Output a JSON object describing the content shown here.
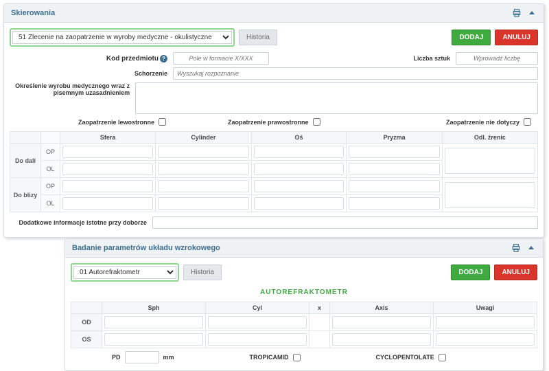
{
  "panel1": {
    "title": "Skierowania",
    "select": "51 Zlecenie na zaopatrzenie w wyroby medyczne - okulistyczne",
    "historyBtn": "Historia",
    "addBtn": "DODAJ",
    "cancelBtn": "ANULUJ",
    "labels": {
      "kod": "Kod przedmiotu",
      "liczba": "Liczba sztuk",
      "schorzenie": "Schorzenie",
      "okreslenie": "Określenie wyrobu medycznego wraz z pisemnym uzasadnieniem",
      "dodatkowe": "Dodatkowe informacje istotne przy doborze"
    },
    "placeholders": {
      "kod": "Pole w formacie X/XXX",
      "liczba": "Wprowadź liczbę",
      "schorzenie": "Wyszukaj rozpoznanie"
    },
    "chk": {
      "lewo": "Zaopatrzenie lewostronne",
      "prawo": "Zaopatrzenie prawostronne",
      "nie": "Zaopatrzenie nie dotyczy"
    },
    "grid": {
      "cols": [
        "Sfera",
        "Cylinder",
        "Oś",
        "Pryzma",
        "Odl. źrenic"
      ],
      "rows": [
        "Do dali",
        "Do blizy"
      ],
      "eyes": [
        "OP",
        "OL"
      ]
    }
  },
  "panel2": {
    "title": "Badanie parametrów układu wzrokowego",
    "select": "01 Autorefraktometr",
    "historyBtn": "Historia",
    "addBtn": "DODAJ",
    "cancelBtn": "ANULUJ",
    "deviceTitle": "AUTOREFRAKTOMETR",
    "grid": {
      "cols": [
        "Sph",
        "Cyl",
        "x",
        "Axis",
        "Uwagi"
      ],
      "eyes": [
        "OD",
        "OS"
      ]
    },
    "pd": {
      "label": "PD",
      "unit": "mm"
    },
    "chk": {
      "tropi": "TROPICAMID",
      "cyclo": "CYCLOPENTOLATE"
    }
  }
}
